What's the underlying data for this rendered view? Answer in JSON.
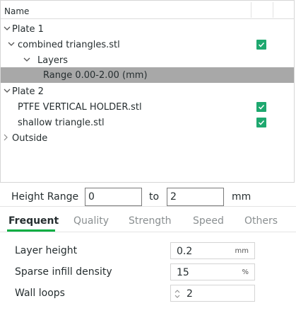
{
  "tree": {
    "header": "Name",
    "rows": [
      {
        "label": "Plate 1",
        "arrow": "down",
        "checked": false
      },
      {
        "label": "combined triangles.stl",
        "arrow": "down",
        "checked": true
      },
      {
        "label": "Layers",
        "arrow": "down",
        "checked": false
      },
      {
        "label": "Range 0.00-2.00 (mm)",
        "arrow": "none",
        "checked": false,
        "selected": true
      },
      {
        "label": "Plate 2",
        "arrow": "down",
        "checked": false
      },
      {
        "label": "PTFE VERTICAL HOLDER.stl",
        "arrow": "none",
        "checked": true
      },
      {
        "label": "shallow triangle.stl",
        "arrow": "none",
        "checked": true
      },
      {
        "label": "Outside",
        "arrow": "right",
        "checked": false
      }
    ]
  },
  "height_range": {
    "label": "Height Range",
    "from_value": "0",
    "to_label": "to",
    "to_value": "2",
    "unit": "mm"
  },
  "tabs": [
    "Frequent",
    "Quality",
    "Strength",
    "Speed",
    "Others"
  ],
  "active_tab": "Frequent",
  "params": [
    {
      "label": "Layer height",
      "value": "0.2",
      "unit": "mm"
    },
    {
      "label": "Sparse infill density",
      "value": "15",
      "unit": "%"
    },
    {
      "label": "Wall loops",
      "value": "2",
      "unit": ""
    }
  ],
  "colors": {
    "accent": "#00ae42",
    "checkbox": "#1ea86f",
    "selected_row": "#a8a8a8"
  },
  "icons": {
    "expanded": "chevron-down-icon",
    "collapsed": "chevron-right-icon",
    "check": "check-icon",
    "stepper": "spin-arrows-icon"
  }
}
